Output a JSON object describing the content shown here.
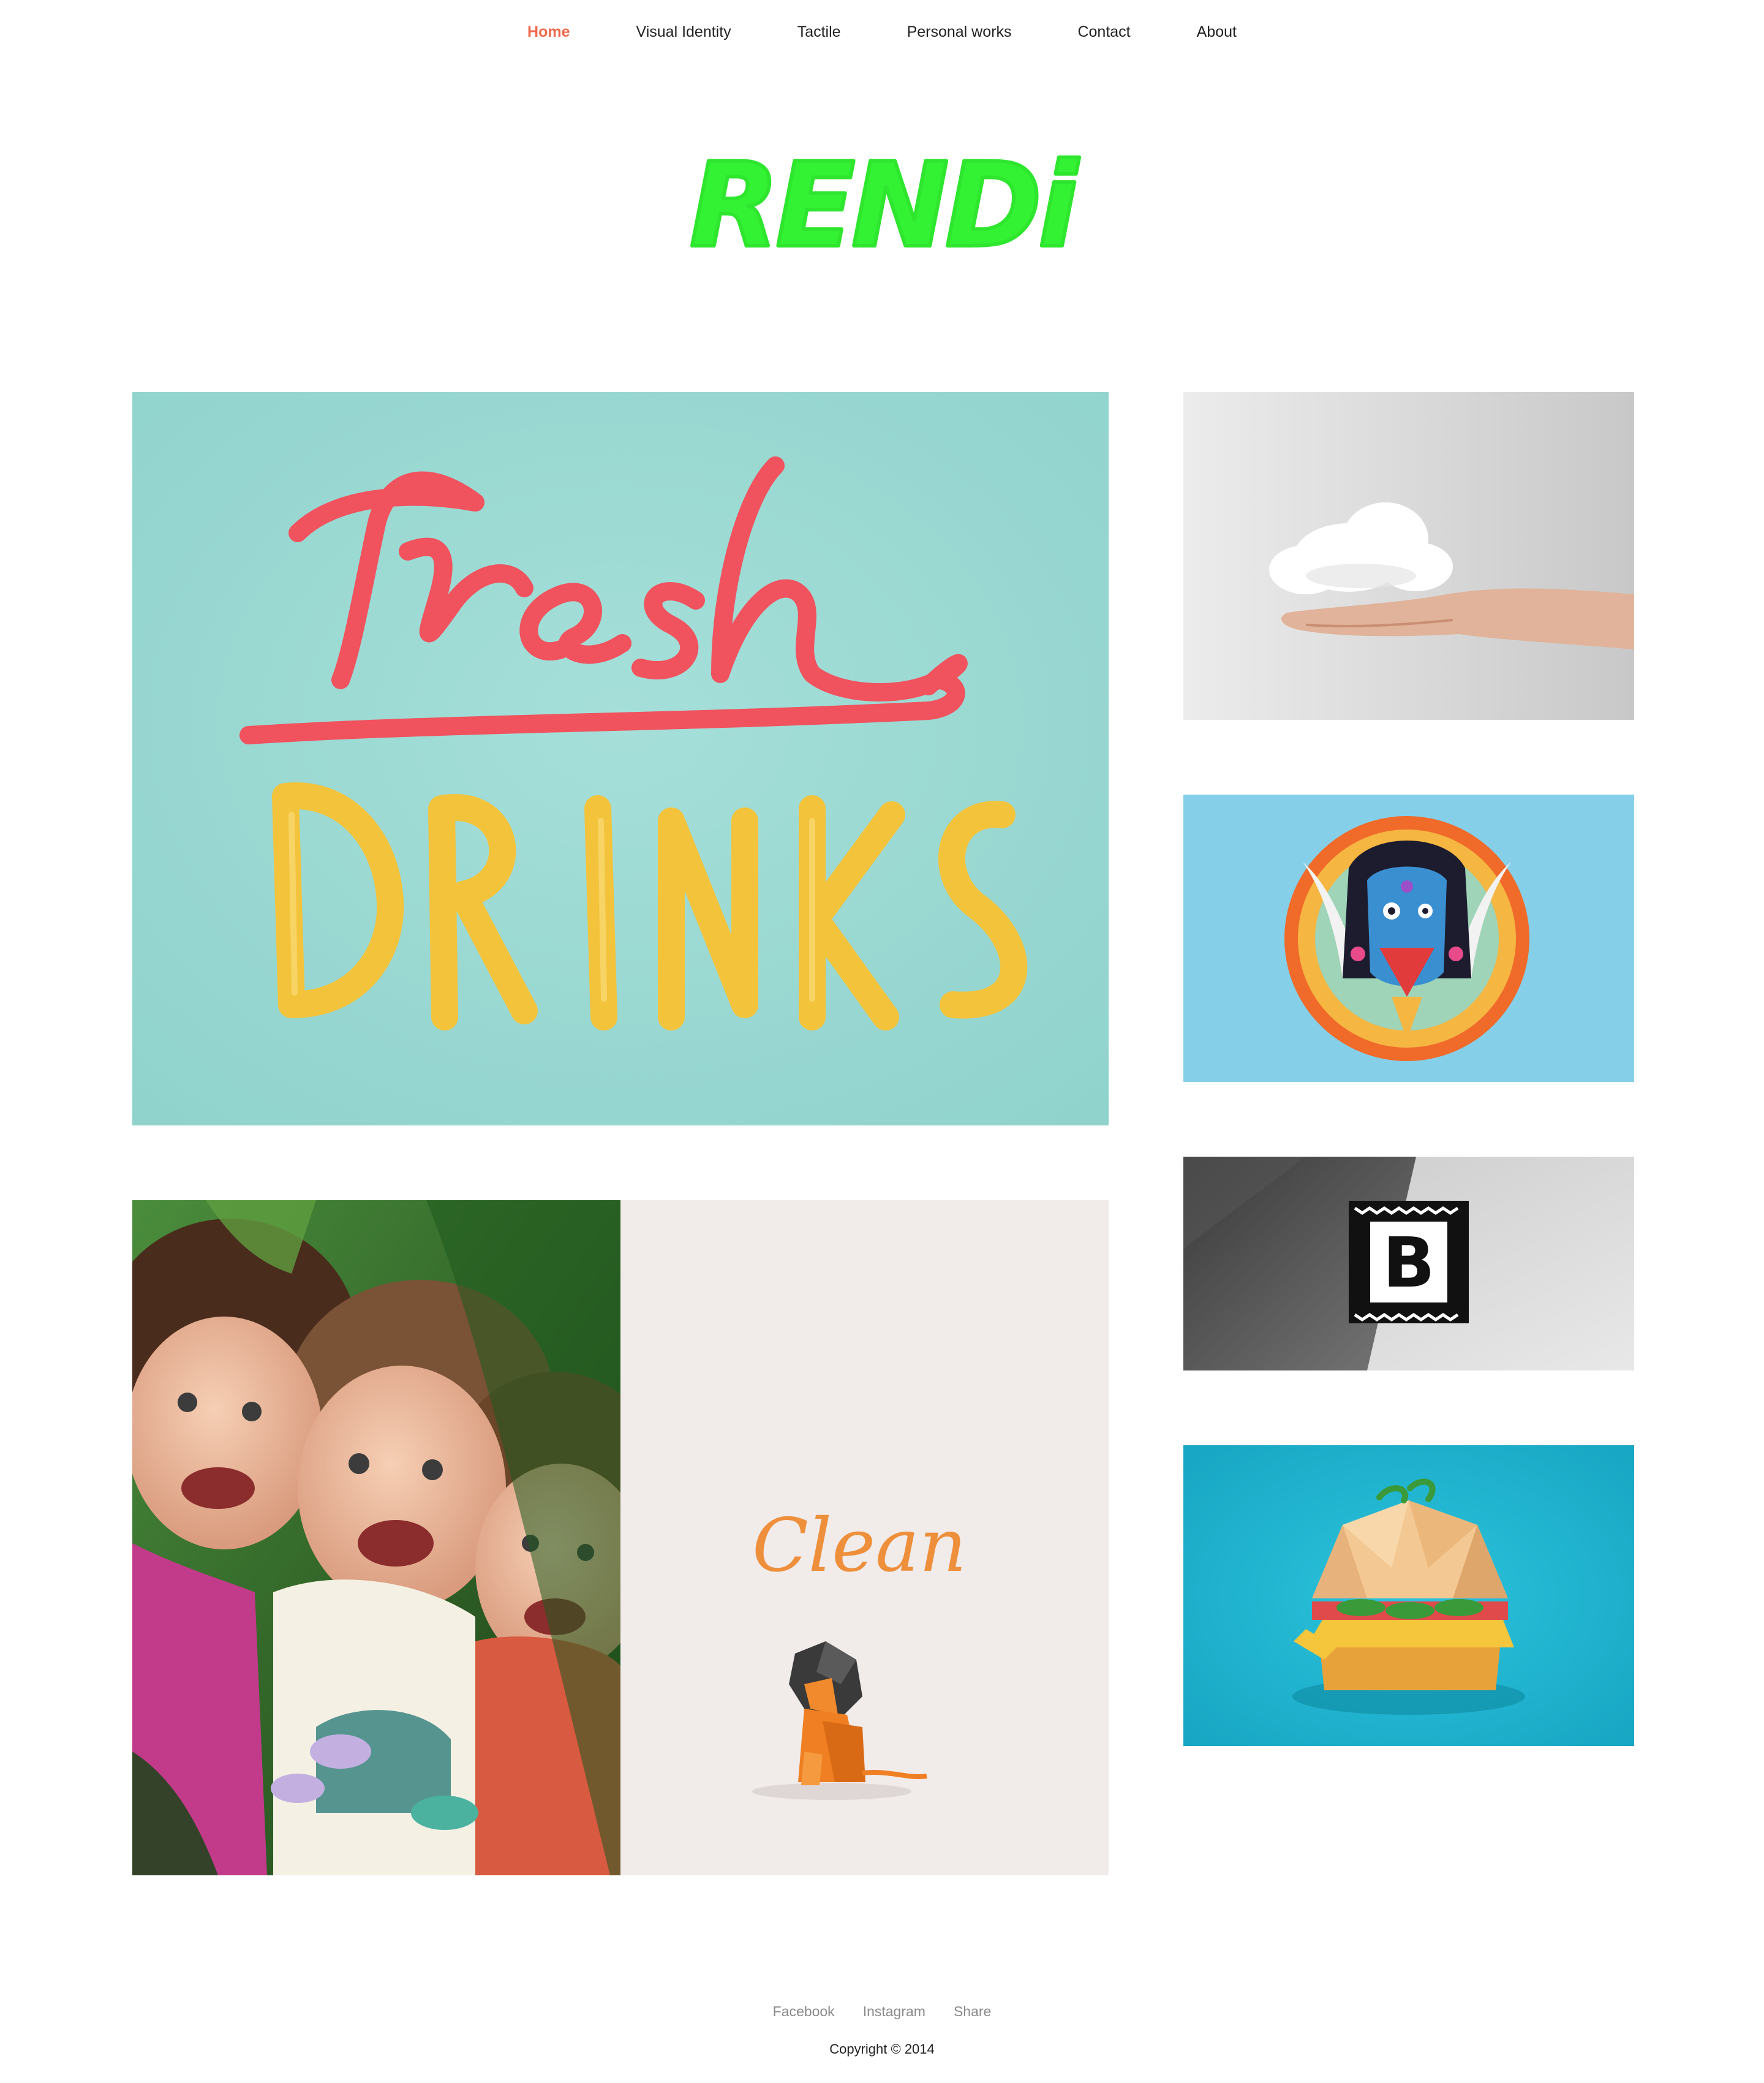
{
  "nav": {
    "items": [
      {
        "label": "Home",
        "active": true
      },
      {
        "label": "Visual Identity",
        "active": false
      },
      {
        "label": "Tactile",
        "active": false
      },
      {
        "label": "Personal works",
        "active": false
      },
      {
        "label": "Contact",
        "active": false
      },
      {
        "label": "About",
        "active": false
      }
    ],
    "active_color": "#ef6a4c"
  },
  "logo": {
    "text": "RENDi",
    "color": "#33f233"
  },
  "portfolio": {
    "fresh_drinks": {
      "script_text": "fresh",
      "block_text": "DRINKS",
      "bg": "#9ad8d2"
    },
    "clean": {
      "text": "Clean",
      "bg": "#f1ebea"
    },
    "kids": {
      "bg": "#2f6b2c"
    },
    "cloud": {
      "bg": "#dcdcdc"
    },
    "kali": {
      "bg": "#86cfe8"
    },
    "b_logo": {
      "letter": "B"
    },
    "burger": {
      "bg": "#1fb6d3"
    }
  },
  "footer": {
    "links": [
      "Facebook",
      "Instagram",
      "Share"
    ],
    "copyright": "Copyright © 2014"
  }
}
